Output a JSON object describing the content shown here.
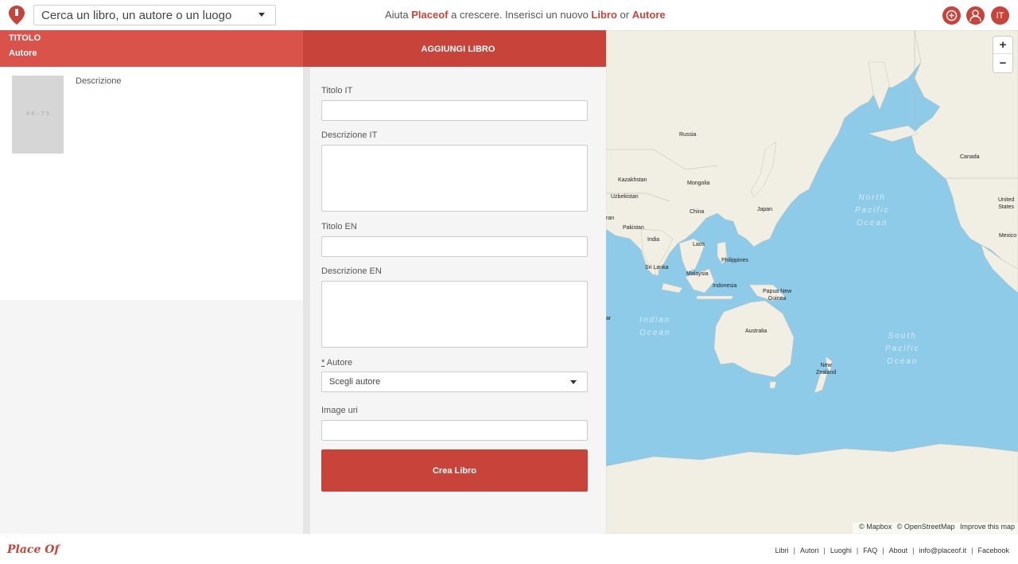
{
  "header": {
    "search_placeholder": "Cerca un libro, un autore o un luogo",
    "promo_pre": "Aiuta ",
    "promo_brand": "Placeof",
    "promo_mid": " a crescere. Inserisci un nuovo ",
    "promo_libro": "Libro",
    "promo_or": " or ",
    "promo_autore": "Autore",
    "lang_label": "IT",
    "accent_color": "#c8443b"
  },
  "preview": {
    "title": "TITOLO",
    "author": "Autore",
    "description": "Descrizione",
    "placeholder_glyph": "00-75"
  },
  "form": {
    "heading": "AGGIUNGI LIBRO",
    "title_it_label": "Titolo IT",
    "desc_it_label": "Descrizione IT",
    "title_en_label": "Titolo EN",
    "desc_en_label": "Descrizione EN",
    "required_mark": "*",
    "author_label": " Autore",
    "author_select_value": "Scegli autore",
    "image_uri_label": "Image uri",
    "submit_label": "Crea Libro"
  },
  "map": {
    "zoom_in": "+",
    "zoom_out": "−",
    "labels": {
      "russia": "Russia",
      "canada": "Canada",
      "kazakhstan": "Kazakhstan",
      "mongolia": "Mongolia",
      "uzbekistan": "Uzbekistan",
      "china": "China",
      "japan": "Japan",
      "iran": "ran",
      "pakistan": "Pakistan",
      "india": "India",
      "laos": "Laos",
      "philippines": "Philippines",
      "sri_lanka": "Sri Lanka",
      "malaysia": "Malaysia",
      "indonesia": "Indonesia",
      "papua": "Papua New\nGuinea",
      "australia": "Australia",
      "new_zealand": "New\nZealand",
      "united_states": "United\nStates",
      "mexico": "Mexico",
      "ar": "ar",
      "north_pacific": "North\nPacific\nOcean",
      "indian_ocean": "Indian\nOcean",
      "south_pacific": "South\nPacific\nOcean"
    },
    "attribution": {
      "mapbox": "© Mapbox",
      "osm": "© OpenStreetMap",
      "improve": "Improve this map"
    },
    "land_color": "#f1efe4",
    "water_color": "#8ecbe9"
  },
  "footer": {
    "logo": "Place Of",
    "links": [
      "Libri",
      "Autori",
      "Luoghi",
      "FAQ",
      "About",
      "info@placeof.it",
      "Facebook"
    ],
    "separator": "|"
  }
}
